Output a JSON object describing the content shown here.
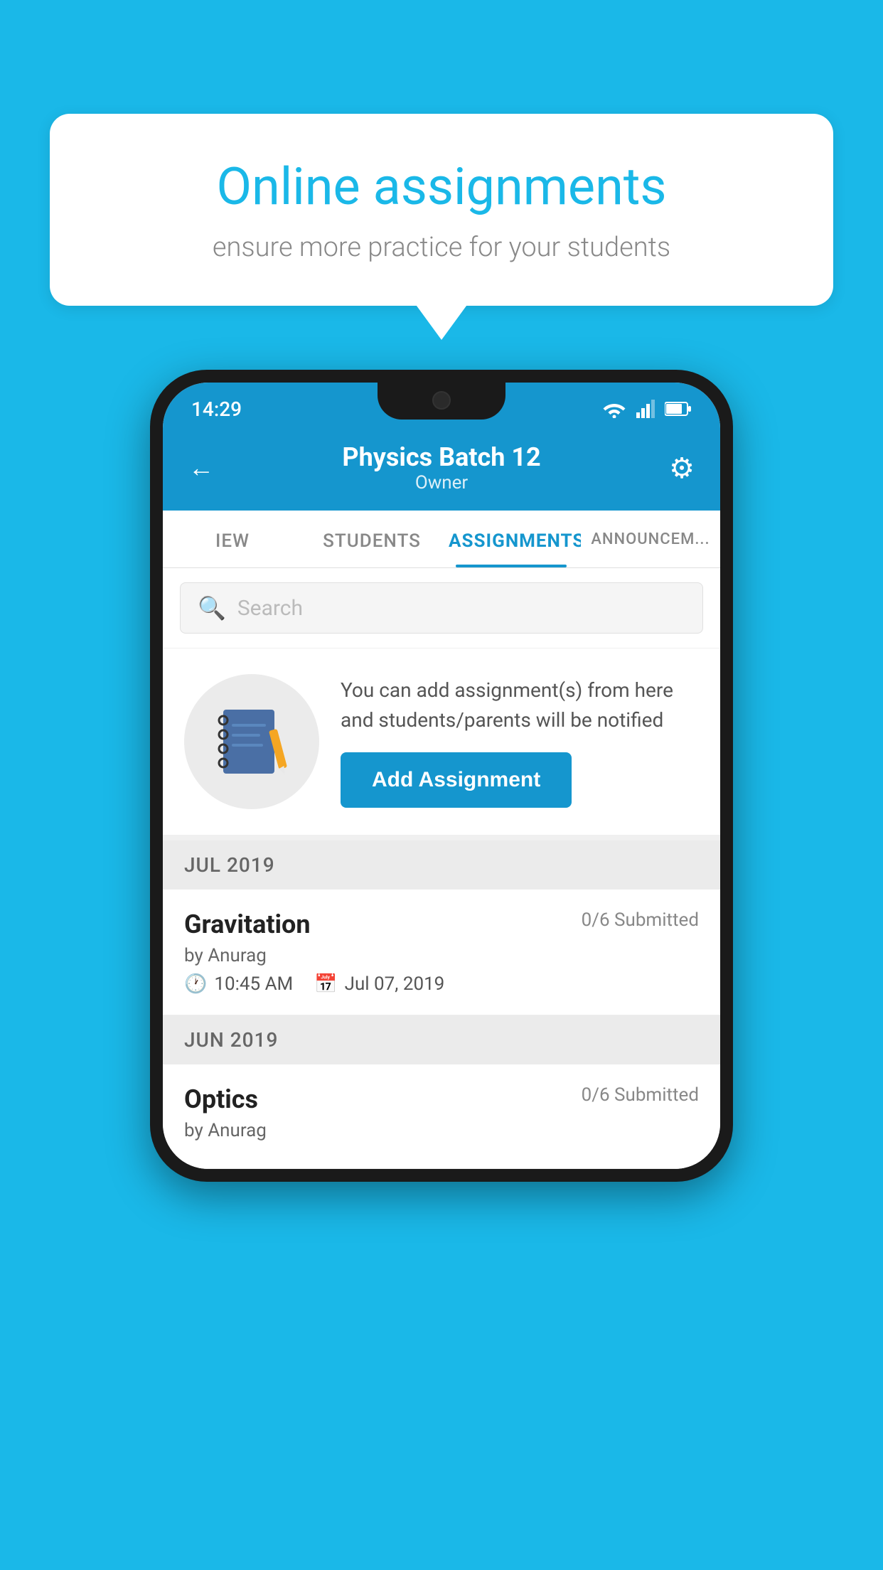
{
  "background_color": "#1ab8e8",
  "speech_bubble": {
    "title": "Online assignments",
    "subtitle": "ensure more practice for your students"
  },
  "status_bar": {
    "time": "14:29",
    "wifi": "wifi",
    "signal": "signal",
    "battery": "battery"
  },
  "app_header": {
    "back_label": "←",
    "title": "Physics Batch 12",
    "subtitle": "Owner",
    "settings_icon": "⚙"
  },
  "tabs": [
    {
      "label": "IEW",
      "active": false
    },
    {
      "label": "STUDENTS",
      "active": false
    },
    {
      "label": "ASSIGNMENTS",
      "active": true
    },
    {
      "label": "ANNOUNCEM...",
      "active": false
    }
  ],
  "search": {
    "placeholder": "Search",
    "icon": "🔍"
  },
  "prompt": {
    "text": "You can add assignment(s) from here and students/parents will be notified",
    "button_label": "Add Assignment"
  },
  "months": [
    {
      "label": "JUL 2019",
      "assignments": [
        {
          "name": "Gravitation",
          "submitted": "0/6 Submitted",
          "by": "by Anurag",
          "time": "10:45 AM",
          "date": "Jul 07, 2019"
        }
      ]
    },
    {
      "label": "JUN 2019",
      "assignments": [
        {
          "name": "Optics",
          "submitted": "0/6 Submitted",
          "by": "by Anurag",
          "time": "",
          "date": ""
        }
      ]
    }
  ]
}
